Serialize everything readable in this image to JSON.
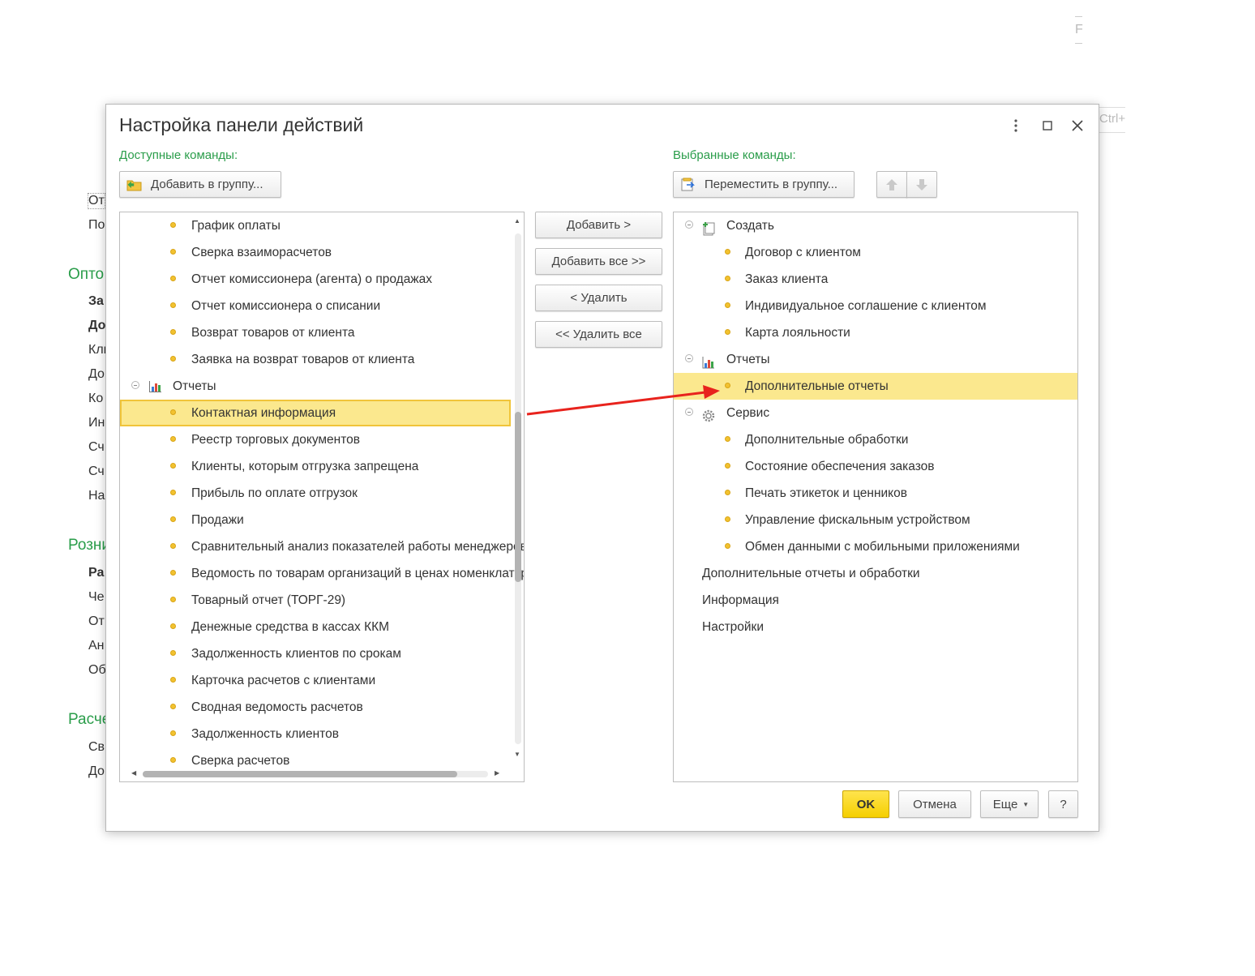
{
  "background": {
    "top_right_char": "F",
    "shortcut_hint": "Ctrl+",
    "items": [
      {
        "text": "От",
        "style": "plain"
      },
      {
        "text": "По",
        "style": "plain"
      },
      {
        "text": "Опто",
        "style": "section"
      },
      {
        "text": "За",
        "style": "bold"
      },
      {
        "text": "До",
        "style": "bold"
      },
      {
        "text": "Кли",
        "style": "plain"
      },
      {
        "text": "До",
        "style": "plain"
      },
      {
        "text": "Ко",
        "style": "plain"
      },
      {
        "text": "Ин",
        "style": "plain"
      },
      {
        "text": "Сч",
        "style": "plain"
      },
      {
        "text": "Сч",
        "style": "plain"
      },
      {
        "text": "На",
        "style": "plain"
      },
      {
        "text": "Розни",
        "style": "section"
      },
      {
        "text": "Ра",
        "style": "bold"
      },
      {
        "text": "Че",
        "style": "plain"
      },
      {
        "text": "От",
        "style": "plain"
      },
      {
        "text": "Ан",
        "style": "plain"
      },
      {
        "text": "Об",
        "style": "plain"
      },
      {
        "text": "Расче",
        "style": "section"
      },
      {
        "text": "Св",
        "style": "plain"
      },
      {
        "text": "До",
        "style": "plain"
      }
    ]
  },
  "dialog": {
    "title": "Настройка панели действий",
    "available_label": "Доступные команды:",
    "selected_label": "Выбранные команды:",
    "add_to_group_button": "Добавить в группу...",
    "move_to_group_button": "Переместить в группу...",
    "middle_buttons": {
      "add": "Добавить >",
      "add_all": "Добавить все >>",
      "remove": "< Удалить",
      "remove_all": "<< Удалить все"
    },
    "available_list": [
      {
        "label": "График оплаты",
        "kind": "item"
      },
      {
        "label": "Сверка взаиморасчетов",
        "kind": "item"
      },
      {
        "label": "Отчет комиссионера (агента) о продажах",
        "kind": "item"
      },
      {
        "label": "Отчет комиссионера о списании",
        "kind": "item"
      },
      {
        "label": "Возврат товаров от клиента",
        "kind": "item"
      },
      {
        "label": "Заявка на возврат товаров от клиента",
        "kind": "item"
      },
      {
        "label": "Отчеты",
        "kind": "group"
      },
      {
        "label": "Контактная информация",
        "kind": "item",
        "selected": true
      },
      {
        "label": "Реестр торговых документов",
        "kind": "item"
      },
      {
        "label": "Клиенты, которым отгрузка запрещена",
        "kind": "item"
      },
      {
        "label": "Прибыль по оплате отгрузок",
        "kind": "item"
      },
      {
        "label": "Продажи",
        "kind": "item"
      },
      {
        "label": "Сравнительный анализ показателей работы менеджеров",
        "kind": "item"
      },
      {
        "label": "Ведомость по товарам организаций в ценах номенклатуры",
        "kind": "item"
      },
      {
        "label": "Товарный отчет (ТОРГ-29)",
        "kind": "item"
      },
      {
        "label": "Денежные средства в кассах ККМ",
        "kind": "item"
      },
      {
        "label": "Задолженность клиентов по срокам",
        "kind": "item"
      },
      {
        "label": "Карточка расчетов с клиентами",
        "kind": "item"
      },
      {
        "label": "Сводная ведомость расчетов",
        "kind": "item"
      },
      {
        "label": "Задолженность клиентов",
        "kind": "item"
      },
      {
        "label": "Сверка расчетов",
        "kind": "item"
      }
    ],
    "selected_list": [
      {
        "label": "Создать",
        "kind": "group",
        "icon": "create-icon"
      },
      {
        "label": "Договор с клиентом",
        "kind": "item"
      },
      {
        "label": "Заказ клиента",
        "kind": "item"
      },
      {
        "label": "Индивидуальное соглашение с клиентом",
        "kind": "item"
      },
      {
        "label": "Карта лояльности",
        "kind": "item"
      },
      {
        "label": "Отчеты",
        "kind": "group",
        "icon": "chart-icon"
      },
      {
        "label": "Дополнительные отчеты",
        "kind": "item",
        "highlighted": true
      },
      {
        "label": "Сервис",
        "kind": "group",
        "icon": "gear-icon"
      },
      {
        "label": "Дополнительные обработки",
        "kind": "item"
      },
      {
        "label": "Состояние обеспечения заказов",
        "kind": "item"
      },
      {
        "label": "Печать этикеток и ценников",
        "kind": "item"
      },
      {
        "label": "Управление фискальным устройством",
        "kind": "item"
      },
      {
        "label": "Обмен данными с мобильными приложениями",
        "kind": "item"
      },
      {
        "label": "Дополнительные отчеты и обработки",
        "kind": "plain"
      },
      {
        "label": "Информация",
        "kind": "plain"
      },
      {
        "label": "Настройки",
        "kind": "plain"
      }
    ],
    "footer": {
      "ok": "OK",
      "cancel": "Отмена",
      "more": "Еще",
      "help": "?"
    }
  },
  "colors": {
    "accent_green": "#2a9d4a",
    "highlight_yellow": "#fbe88e",
    "ok_yellow": "#f5cf00",
    "arrow_red": "#e8231d"
  }
}
